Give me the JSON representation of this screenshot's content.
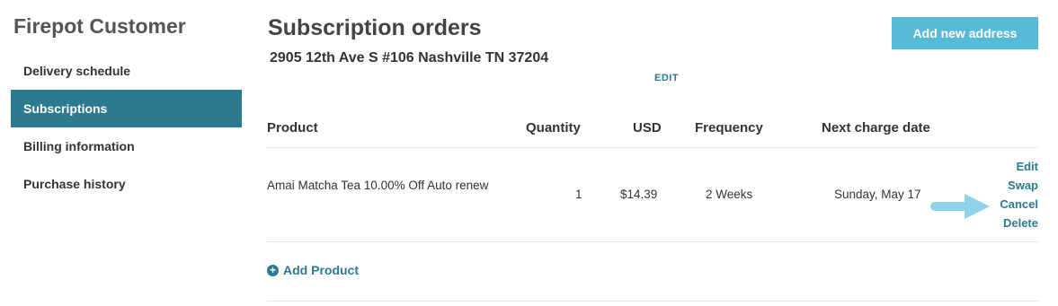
{
  "sidebar": {
    "title": "Firepot Customer",
    "items": [
      {
        "label": "Delivery schedule",
        "active": false
      },
      {
        "label": "Subscriptions",
        "active": true
      },
      {
        "label": "Billing information",
        "active": false
      },
      {
        "label": "Purchase history",
        "active": false
      }
    ]
  },
  "main": {
    "title": "Subscription orders",
    "address": "2905 12th Ave S #106 Nashville TN 37204",
    "edit_address_label": "EDIT",
    "add_address_label": "Add new address",
    "table": {
      "headers": [
        "Product",
        "Quantity",
        "USD",
        "Frequency",
        "Next charge date"
      ],
      "rows": [
        {
          "product": "Amai Matcha Tea 10.00% Off Auto renew",
          "quantity": "1",
          "price": "$14.39",
          "frequency": "2 Weeks",
          "next_charge": "Sunday, May 17",
          "actions": [
            "Edit",
            "Swap",
            "Cancel",
            "Delete"
          ]
        }
      ]
    },
    "add_product_label": "Add Product"
  },
  "colors": {
    "accent": "#2b7a8f",
    "button": "#56bcd6",
    "arrow": "#8fd3ea"
  },
  "icons": {
    "add_product": "plus-circle-icon",
    "pointer": "arrow-right-icon"
  }
}
